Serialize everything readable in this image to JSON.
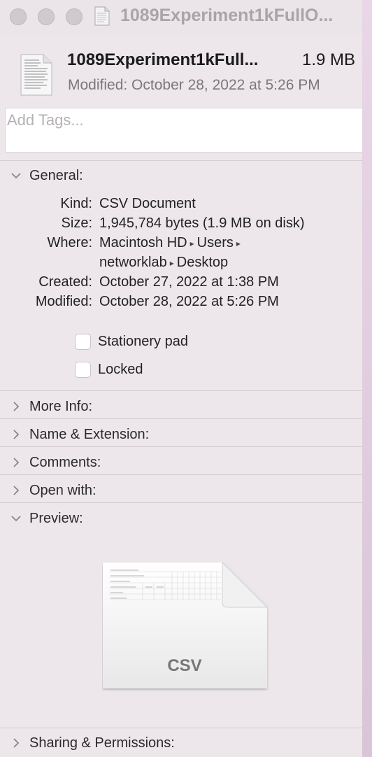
{
  "window": {
    "title": "1089Experiment1kFullO..."
  },
  "header": {
    "file_name": "1089Experiment1kFull...",
    "file_size": "1.9 MB",
    "modified": "Modified: October 28, 2022 at 5:26 PM"
  },
  "tags": {
    "placeholder": "Add Tags..."
  },
  "general": {
    "label": "General:",
    "rows": [
      {
        "key": "Kind:",
        "value": "CSV Document"
      },
      {
        "key": "Size:",
        "value": "1,945,784 bytes (1.9 MB on disk)"
      },
      {
        "key": "Where:",
        "value_parts": [
          "Macintosh HD",
          "Users"
        ]
      },
      {
        "key": "",
        "value_parts": [
          "networklab",
          "Desktop"
        ]
      },
      {
        "key": "Created:",
        "value": "October 27, 2022 at 1:38 PM"
      },
      {
        "key": "Modified:",
        "value": "October 28, 2022 at 5:26 PM"
      }
    ],
    "path_separator": "▸",
    "stationery_label": "Stationery pad",
    "locked_label": "Locked"
  },
  "sections": {
    "more_info": "More Info:",
    "name_extension": "Name & Extension:",
    "comments": "Comments:",
    "open_with": "Open with:",
    "preview": "Preview:",
    "sharing": "Sharing & Permissions:"
  },
  "preview": {
    "extension": "CSV"
  },
  "icons": {
    "collapsed": "chevron-right-icon",
    "expanded": "chevron-down-icon",
    "document": "document-icon"
  }
}
